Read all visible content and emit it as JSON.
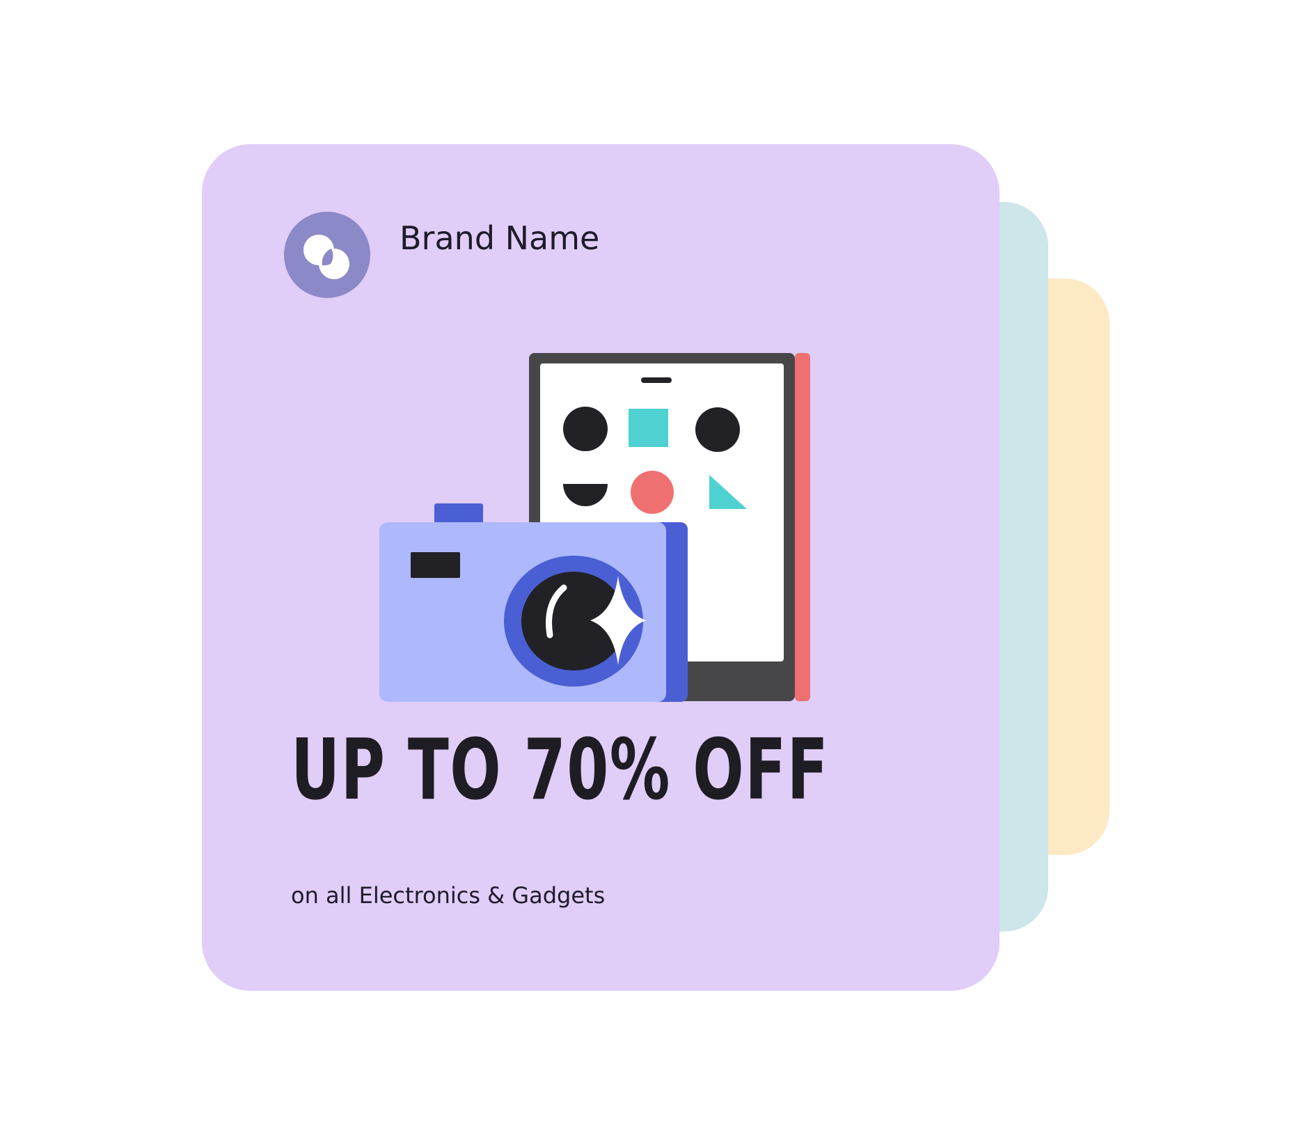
{
  "brand": {
    "name": "Brand Name",
    "logo_icon": "overlapping-circles-icon"
  },
  "promo": {
    "headline": "UP TO 70% OFF",
    "subline": "on all Electronics & Gadgets"
  },
  "illustration": {
    "items": [
      "camera-icon",
      "smartphone-icon"
    ]
  },
  "colors": {
    "card_front": "#e0cdf8",
    "card_back_teal": "#cce6ea",
    "card_back_yellow": "#fde9c3",
    "logo_circle": "#8b89c8",
    "camera_body": "#adb9fc",
    "camera_accent": "#4b5fd4",
    "phone_frame": "#47474a",
    "phone_side": "#ef7070",
    "teal_shape": "#4fd1d1",
    "dark": "#222226"
  }
}
